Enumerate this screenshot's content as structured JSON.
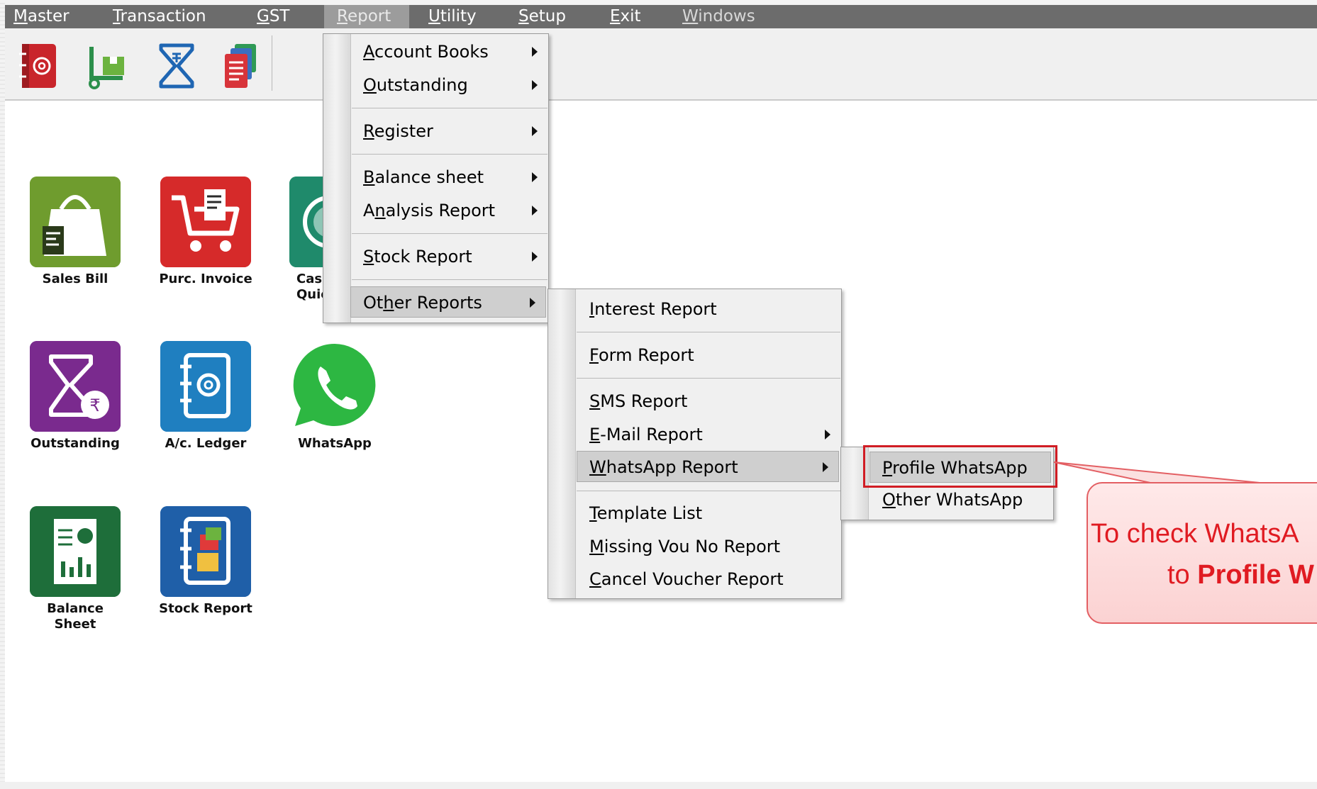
{
  "menubar": {
    "items": [
      {
        "label": "Master",
        "accel": "M",
        "rest": "aster"
      },
      {
        "label": "Transaction",
        "accel": "T",
        "rest": "ransaction"
      },
      {
        "label": "GST",
        "accel": "G",
        "rest": "ST"
      },
      {
        "label": "Report",
        "accel": "R",
        "rest": "eport"
      },
      {
        "label": "Utility",
        "accel": "U",
        "rest": "tility"
      },
      {
        "label": "Setup",
        "accel": "S",
        "rest": "etup"
      },
      {
        "label": "Exit",
        "accel": "E",
        "rest": "xit"
      },
      {
        "label": "Windows",
        "accel": "W",
        "rest": "indows"
      }
    ]
  },
  "toolbar": {
    "icons": [
      "address-book-icon",
      "goods-receipt-icon",
      "hourglass-sigma-icon",
      "documents-icon"
    ]
  },
  "tiles": [
    {
      "label": "Sales Bill",
      "icon": "shopping-bag-icon",
      "color": "#6f9c2e"
    },
    {
      "label": "Purc. Invoice",
      "icon": "shopping-cart-icon",
      "color": "#d62a2a"
    },
    {
      "label_line1": "Cas",
      "label_line2": "Quic",
      "icon": "cash-icon",
      "color": "#1f8a6b"
    },
    {
      "label": "Outstanding",
      "icon": "sigma-rupee-icon",
      "color": "#7a2a8e"
    },
    {
      "label": "A/c. Ledger",
      "icon": "ledger-book-icon",
      "color": "#1f7fc0"
    },
    {
      "label": "WhatsApp",
      "icon": "whatsapp-icon",
      "color": "#2db742"
    },
    {
      "label_line1": "Balance",
      "label_line2": "Sheet",
      "icon": "balance-sheet-icon",
      "color": "#1e6e3a"
    },
    {
      "label": "Stock Report",
      "icon": "stock-report-icon",
      "color": "#1f5fa8"
    }
  ],
  "report_menu": {
    "items": [
      {
        "pre": "",
        "accel": "A",
        "rest": "ccount Books"
      },
      {
        "pre": "",
        "accel": "O",
        "rest": "utstanding"
      },
      {
        "pre": "",
        "accel": "R",
        "rest": "egister"
      },
      {
        "pre": "",
        "accel": "B",
        "rest": "alance sheet"
      },
      {
        "pre": "A",
        "accel": "n",
        "rest": "alysis Report"
      },
      {
        "pre": "",
        "accel": "S",
        "rest": "tock Report"
      },
      {
        "pre": "Ot",
        "accel": "h",
        "rest": "er Reports"
      }
    ]
  },
  "other_reports_menu": {
    "items": [
      {
        "pre": "",
        "accel": "I",
        "rest": "nterest Report"
      },
      {
        "pre": "",
        "accel": "F",
        "rest": "orm Report"
      },
      {
        "pre": "",
        "accel": "S",
        "rest": "MS Report"
      },
      {
        "pre": "",
        "accel": "E",
        "rest": "-Mail Report"
      },
      {
        "pre": "",
        "accel": "W",
        "rest": "hatsApp Report"
      },
      {
        "pre": "",
        "accel": "T",
        "rest": "emplate List"
      },
      {
        "pre": "",
        "accel": "M",
        "rest": "issing Vou No Report"
      },
      {
        "pre": "",
        "accel": "C",
        "rest": "ancel Voucher Report"
      }
    ]
  },
  "whatsapp_menu": {
    "items": [
      {
        "pre": "",
        "accel": "P",
        "rest": "rofile WhatsApp"
      },
      {
        "pre": "",
        "accel": "O",
        "rest": "ther WhatsApp"
      }
    ]
  },
  "callout": {
    "line1": "To check WhatsA",
    "line2_pre": "to ",
    "line2_bold": "Profile W"
  },
  "colors": {
    "menubar": "#6c6c6c",
    "highlight_box": "#d11d24",
    "callout_text": "#e01b22"
  }
}
